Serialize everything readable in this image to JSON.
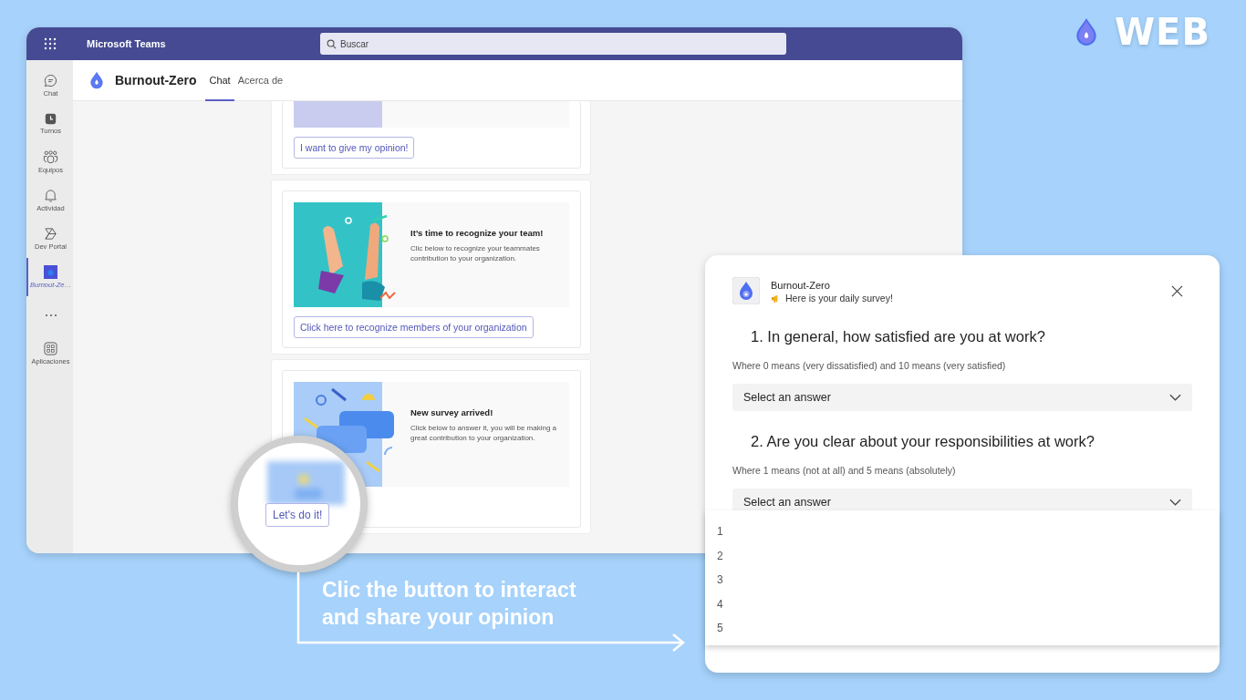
{
  "branding": {
    "label": "WEB"
  },
  "teams": {
    "title": "Microsoft Teams",
    "search": {
      "placeholder": "Buscar"
    },
    "rail": [
      {
        "kind": "chat",
        "label": "Chat",
        "selected": false
      },
      {
        "kind": "shifts",
        "label": "Turnos",
        "selected": false
      },
      {
        "kind": "teams",
        "label": "Equipos",
        "selected": false
      },
      {
        "kind": "activity",
        "label": "Actividad",
        "selected": false
      },
      {
        "kind": "devportal",
        "label": "Dev Portal",
        "selected": false
      },
      {
        "kind": "app",
        "label": "Burnout-Ze…",
        "selected": true
      },
      {
        "kind": "more",
        "selected": false
      },
      {
        "kind": "apps",
        "label": "Aplicaciones",
        "selected": false
      }
    ],
    "app": {
      "name": "Burnout-Zero",
      "tabs": [
        {
          "label": "Chat",
          "selected": true
        },
        {
          "label": "Acerca de",
          "selected": false
        }
      ]
    },
    "cards": [
      {
        "kind": "opinion",
        "button": "I want to give my opinion!"
      },
      {
        "kind": "recognize",
        "title": "It’s time to recognize your team!",
        "body": "Clic below to recognize your teammates contribution to your organization.",
        "button": "Click here to recognize members of your organization"
      },
      {
        "kind": "survey",
        "title": "New survey arrived!",
        "body": "Click below to answer it, you will be making a great contribution to your organization."
      }
    ]
  },
  "magnifier": {
    "button": "Let's do it!"
  },
  "callout": {
    "lines": [
      "Clic the button to interact",
      "and share your opinion"
    ]
  },
  "popup": {
    "app": "Burnout-Zero",
    "subtitle": "Here is your daily survey!",
    "questions": [
      {
        "title": "1. In general, how satisfied are you at work?",
        "hint": "Where 0 means (very dissatisfied) and 10 means (very satisfied)",
        "placeholder": "Select an answer",
        "expanded": false
      },
      {
        "title": "2. Are you clear about your responsibilities at work?",
        "hint": "Where 1 means (not at all) and 5 means (absolutely)",
        "placeholder": "Select an answer",
        "expanded": true,
        "options": [
          "1",
          "2",
          "3",
          "4",
          "5"
        ]
      }
    ]
  }
}
